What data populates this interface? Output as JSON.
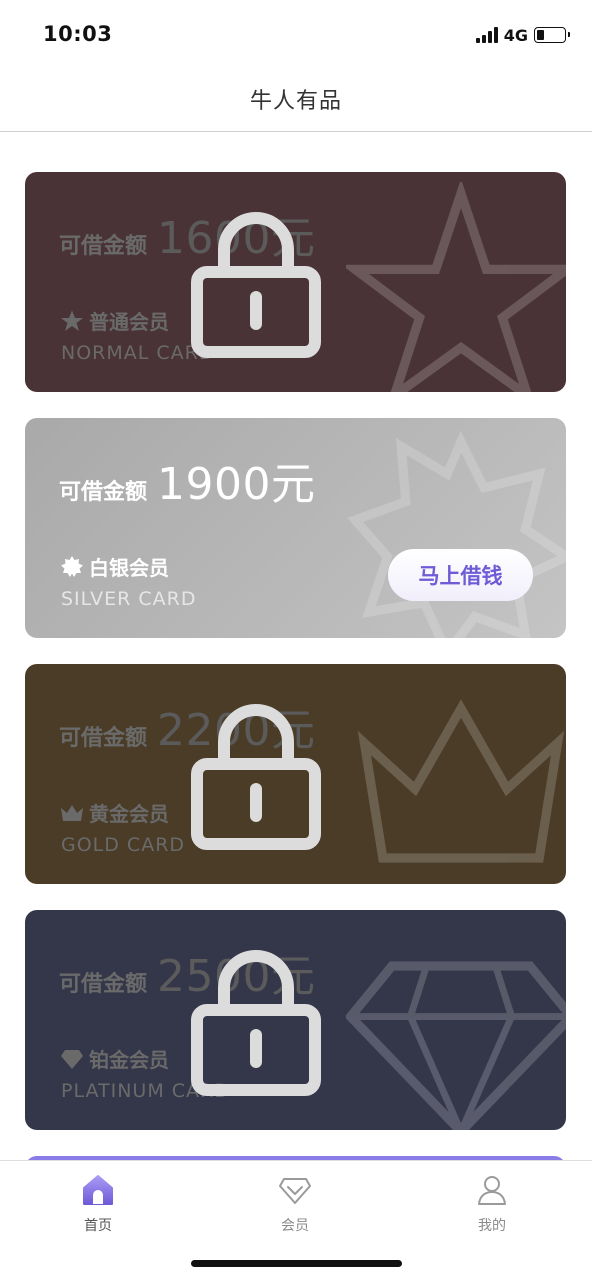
{
  "status_bar": {
    "time": "10:03",
    "network": "4G",
    "battery_level": 0.2
  },
  "nav": {
    "title": "牛人有品"
  },
  "cards": [
    {
      "amount_label": "可借金额",
      "amount": "1600元",
      "tier_name": "普通会员",
      "tier_en": "NORMAL CARD",
      "tier_icon": "star-icon",
      "locked": true,
      "color": "#4a3336"
    },
    {
      "amount_label": "可借金额",
      "amount": "1900元",
      "tier_name": "白银会员",
      "tier_en": "SILVER CARD",
      "tier_icon": "badge-icon",
      "locked": false,
      "button_label": "马上借钱",
      "color": "#b3b3b3"
    },
    {
      "amount_label": "可借金额",
      "amount": "2200元",
      "tier_name": "黄金会员",
      "tier_en": "GOLD CARD",
      "tier_icon": "crown-icon",
      "locked": true,
      "color": "#4a3c27"
    },
    {
      "amount_label": "可借金额",
      "amount": "2500元",
      "tier_name": "铂金会员",
      "tier_en": "PLATINUM CARD",
      "tier_icon": "diamond-icon",
      "locked": true,
      "color": "#34364a"
    }
  ],
  "tabs": [
    {
      "label": "首页",
      "icon": "home-icon",
      "active": true
    },
    {
      "label": "会员",
      "icon": "diamond-icon",
      "active": false
    },
    {
      "label": "我的",
      "icon": "user-icon",
      "active": false
    }
  ],
  "colors": {
    "accent": "#8a7be9",
    "button_text": "#6e5bd6"
  }
}
